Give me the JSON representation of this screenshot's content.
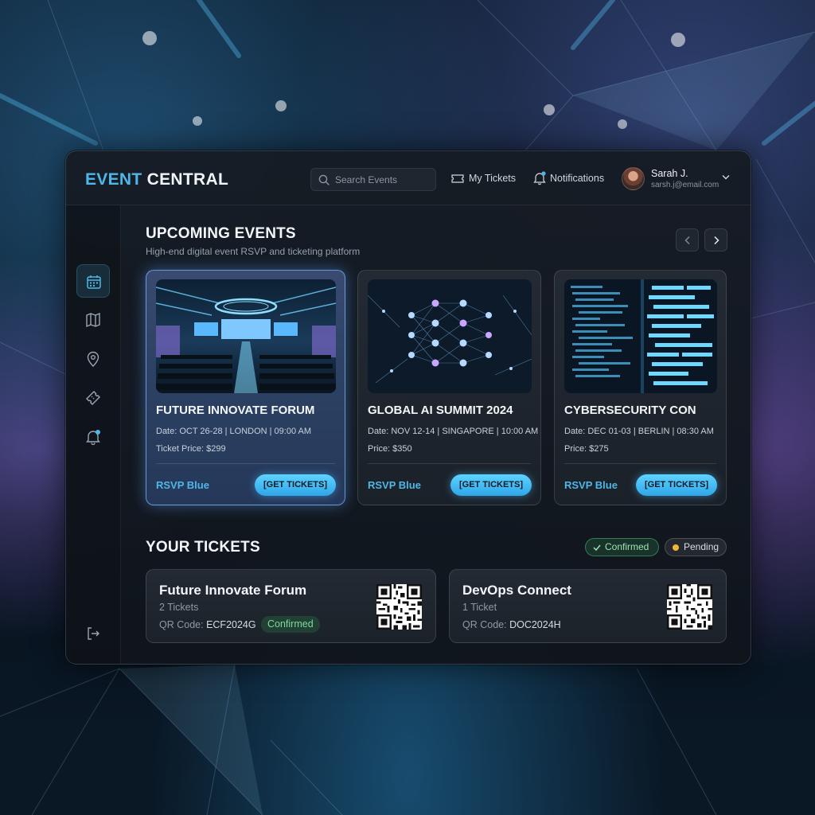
{
  "app": {
    "brand_part1": "EVENT",
    "brand_part2": "CENTRAL"
  },
  "header": {
    "search_placeholder": "Search Events",
    "my_tickets": "My Tickets",
    "notifications": "Notifications",
    "user_name": "Sarah J.",
    "user_email": "sarsh.j@email.com"
  },
  "sidebar": {
    "items": [
      {
        "icon": "calendar-icon",
        "active": true
      },
      {
        "icon": "map-icon",
        "active": false
      },
      {
        "icon": "location-pin-icon",
        "active": false
      },
      {
        "icon": "ticket-icon",
        "active": false
      },
      {
        "icon": "bell-icon",
        "active": false,
        "has_dot": true
      }
    ],
    "bottom_icon": "logout-icon"
  },
  "upcoming": {
    "title": "UPCOMING EVENTS",
    "subtitle": "High-end digital event RSVP and ticketing platform",
    "events": [
      {
        "title": "FUTURE INNOVATE FORUM",
        "meta": "Date: OCT 26-28 | LONDON | 09:00 AM",
        "price": "Ticket Price: $299",
        "rsvp": "RSVP Blue",
        "button": "[GET TICKETS]"
      },
      {
        "title": "GLOBAL AI SUMMIT 2024",
        "meta": "Date: NOV 12-14 | SINGAPORE | 10:00 AM",
        "price": "Price: $350",
        "rsvp": "RSVP Blue",
        "button": "[GET TICKETS]"
      },
      {
        "title": "CYBERSECURITY CON",
        "meta": "Date: DEC 01-03 | BERLIN | 08:30 AM",
        "price": "Price: $275",
        "rsvp": "RSVP Blue",
        "button": "[GET TICKETS]"
      }
    ]
  },
  "tickets": {
    "title": "YOUR TICKETS",
    "filter_confirmed": "Confirmed",
    "filter_pending": "Pending",
    "items": [
      {
        "name": "Future Innovate Forum",
        "count": "2 Tickets",
        "qr_label": "QR Code: ",
        "qr_value": "ECF2024G",
        "status": "Confirmed"
      },
      {
        "name": "DevOps Connect",
        "count": "1 Ticket",
        "qr_label": "QR Code: ",
        "qr_value": "DOC2024H"
      }
    ]
  },
  "colors": {
    "accent": "#4fb6e8",
    "confirmed": "#7fd89c",
    "pending_dot": "#f2b534"
  }
}
